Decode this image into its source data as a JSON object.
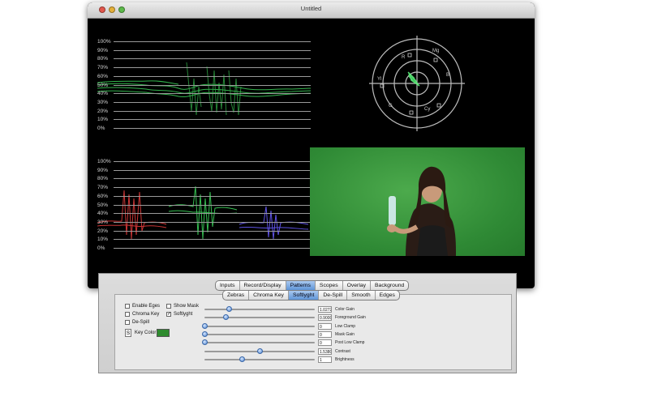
{
  "window": {
    "title": "Untitled"
  },
  "scope_top": {
    "labels": [
      "100%",
      "90%",
      "80%",
      "70%",
      "60%",
      "50%",
      "40%",
      "30%",
      "20%",
      "10%",
      "0%"
    ]
  },
  "scope_bottom": {
    "labels": [
      "100%",
      "90%",
      "80%",
      "70%",
      "60%",
      "50%",
      "40%",
      "30%",
      "20%",
      "10%",
      "0%"
    ]
  },
  "vectorscope": {
    "labels": [
      "R",
      "Mg",
      "B",
      "Cy",
      "G",
      "Yl"
    ]
  },
  "tabs_main": [
    "Inputs",
    "Record/Display",
    "Patterns",
    "Scopes",
    "Overlay",
    "Background"
  ],
  "tabs_main_selected": "Patterns",
  "tabs_sub": [
    "Zebras",
    "Chroma Key",
    "Softlyght",
    "De-Spill",
    "Smooth",
    "Edges"
  ],
  "tabs_sub_selected": "Softlyght",
  "checkboxes": {
    "enable_edges": {
      "label": "Enable Eges",
      "checked": false
    },
    "chroma_key": {
      "label": "Chroma Key",
      "checked": false
    },
    "de_spill": {
      "label": "De-Spill",
      "checked": false
    },
    "show_mask": {
      "label": "Show Mask",
      "checked": false
    },
    "softlyght": {
      "label": "Softlyght",
      "checked": true
    }
  },
  "key_color": {
    "swatch_label": "S",
    "label": "Key Color",
    "color": "#2e8b2e"
  },
  "params": [
    {
      "label": "Color Gain",
      "value": "1.0272",
      "level": 0.22
    },
    {
      "label": "Foreground Gain",
      "value": "0.9000",
      "level": 0.19
    },
    {
      "label": "Low Clamp",
      "value": "0",
      "level": 0.0
    },
    {
      "label": "Mask Gain",
      "value": "0",
      "level": 0.0
    },
    {
      "label": "Post Low Clamp",
      "value": "0",
      "level": 0.0
    },
    {
      "label": "Contrast",
      "value": "1.5380",
      "level": 0.5
    },
    {
      "label": "Brightness",
      "value": "1",
      "level": 0.34
    }
  ],
  "video": {
    "subject": "woman holding water bottle on green screen"
  }
}
